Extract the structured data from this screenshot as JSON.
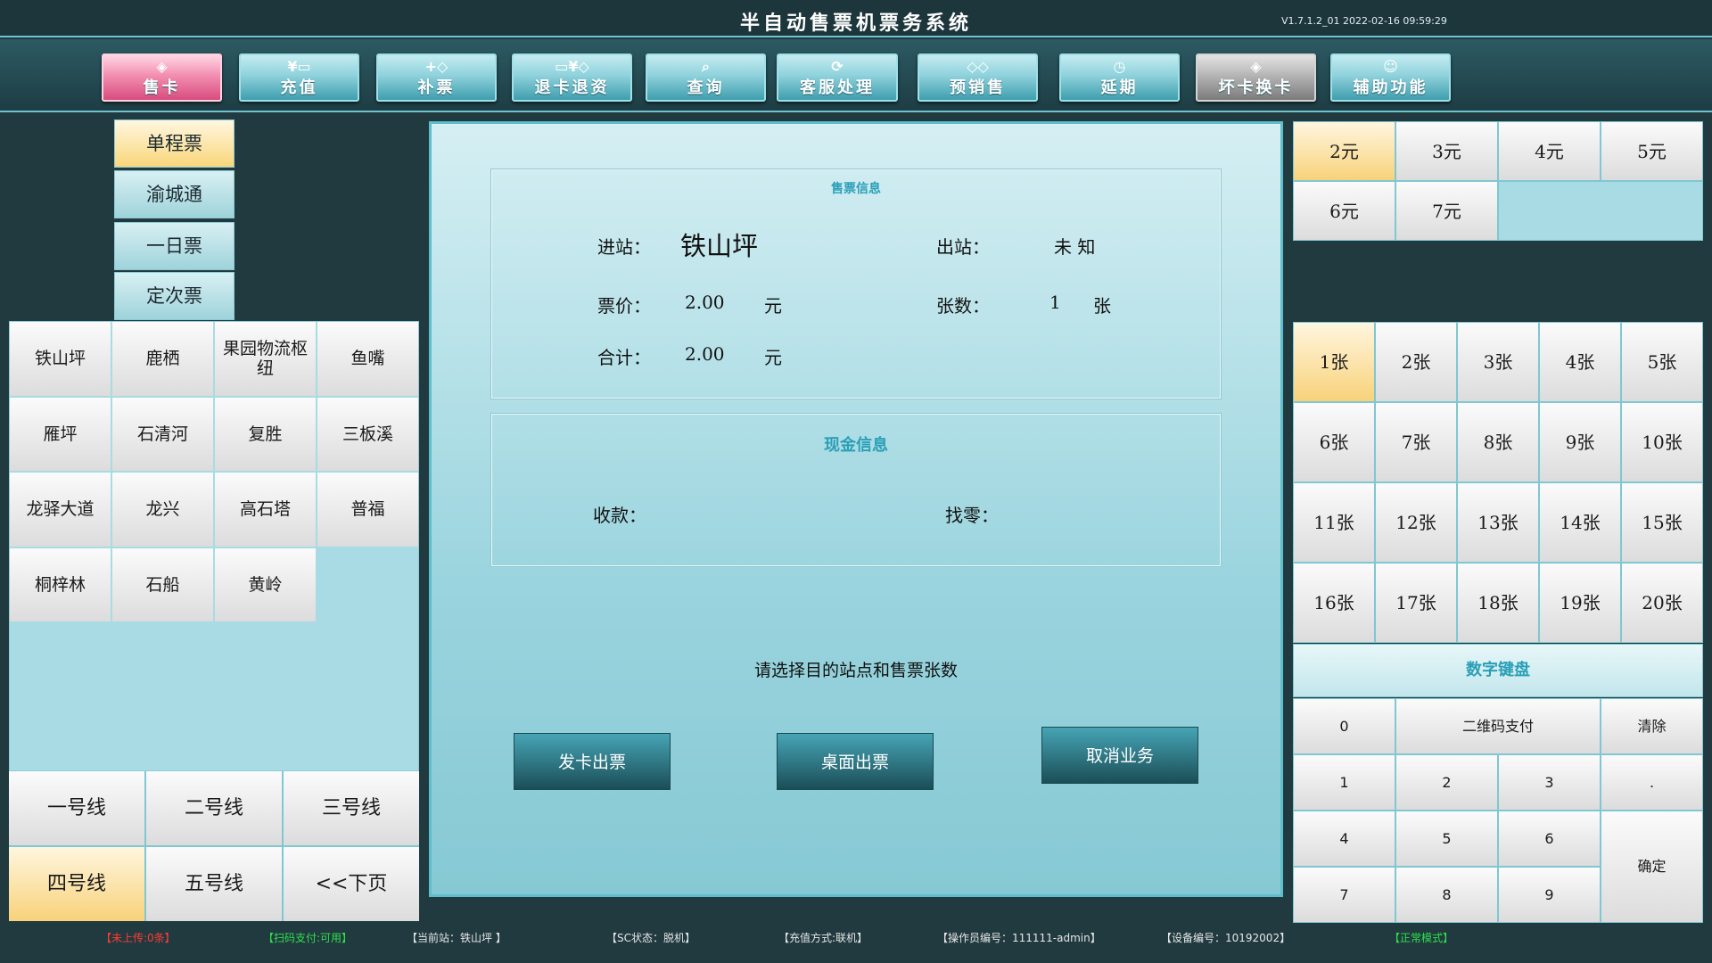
{
  "app": {
    "title": "半自动售票机票务系统",
    "version": "V1.7.1.2_01  2022-02-16 09:59:29"
  },
  "toolbar": [
    {
      "label": "售卡",
      "icon": "card-icon",
      "glyph": "◈"
    },
    {
      "label": "充值",
      "icon": "recharge-icon",
      "glyph": "¥▭"
    },
    {
      "label": "补票",
      "icon": "supplement-ticket-icon",
      "glyph": "+◇"
    },
    {
      "label": "退卡退资",
      "icon": "refund-icon",
      "glyph": "▭¥◇"
    },
    {
      "label": "查询",
      "icon": "magnifier-icon",
      "glyph": "⌕"
    },
    {
      "label": "客服处理",
      "icon": "customer-service-icon",
      "glyph": "⟳"
    },
    {
      "label": "预销售",
      "icon": "presale-icon",
      "glyph": "◇◇"
    },
    {
      "label": "延期",
      "icon": "clock-icon",
      "glyph": "◷"
    },
    {
      "label": "坏卡换卡",
      "icon": "broken-card-icon",
      "glyph": "◈"
    },
    {
      "label": "辅助功能",
      "icon": "user-icon",
      "glyph": "☺"
    }
  ],
  "ticket_types": [
    "单程票",
    "渝城通",
    "一日票",
    "定次票"
  ],
  "stations": [
    "铁山坪",
    "鹿栖",
    "果园物流枢纽",
    "鱼嘴",
    "雁坪",
    "石清河",
    "复胜",
    "三板溪",
    "龙驿大道",
    "龙兴",
    "高石塔",
    "普福",
    "桐梓林",
    "石船",
    "黄岭"
  ],
  "lines": [
    "一号线",
    "二号线",
    "三号线",
    "四号线",
    "五号线",
    "<<下页"
  ],
  "ticket_info": {
    "title": "售票信息",
    "entry_label": "进站：",
    "entry_value": "铁山坪",
    "exit_label": "出站：",
    "exit_value": "未 知",
    "price_label": "票价：",
    "price_value": "2.00",
    "price_unit": "元",
    "count_label": "张数：",
    "count_value": "1",
    "count_unit": "张",
    "total_label": "合计：",
    "total_value": "2.00",
    "total_unit": "元"
  },
  "cash_info": {
    "title": "现金信息",
    "received_label": "收款：",
    "change_label": "找零："
  },
  "prompt": "请选择目的站点和售票张数",
  "actions": {
    "issue_card": "发卡出票",
    "desk_issue": "桌面出票",
    "cancel": "取消业务"
  },
  "prices": [
    "2元",
    "3元",
    "4元",
    "5元",
    "6元",
    "7元"
  ],
  "quantities": [
    "1张",
    "2张",
    "3张",
    "4张",
    "5张",
    "6张",
    "7张",
    "8张",
    "9张",
    "10张",
    "11张",
    "12张",
    "13张",
    "14张",
    "15张",
    "16张",
    "17张",
    "18张",
    "19张",
    "20张"
  ],
  "keypad": {
    "title": "数字键盘",
    "keys": {
      "k0": "0",
      "qr": "二维码支付",
      "clear": "清除",
      "k1": "1",
      "k2": "2",
      "k3": "3",
      "dot": ".",
      "k4": "4",
      "k5": "5",
      "k6": "6",
      "confirm": "确定",
      "k7": "7",
      "k8": "8",
      "k9": "9"
    }
  },
  "status": {
    "upload": "【未上传:0条】",
    "scan_pay": "【扫码支付:可用】",
    "current_station": "【当前站：铁山坪 】",
    "sc_state": "【SC状态：脱机】",
    "recharge_mode": "【充值方式:联机】",
    "operator": "【操作员编号：111111-admin】",
    "device": "【设备编号：10192002】",
    "mode": "【正常模式】"
  },
  "colors": {
    "upload": "#ff3b30",
    "scan_pay": "#2ee04a",
    "mode": "#2ee04a",
    "accent": "#2a9fb7",
    "selected": "#f8d27a"
  }
}
